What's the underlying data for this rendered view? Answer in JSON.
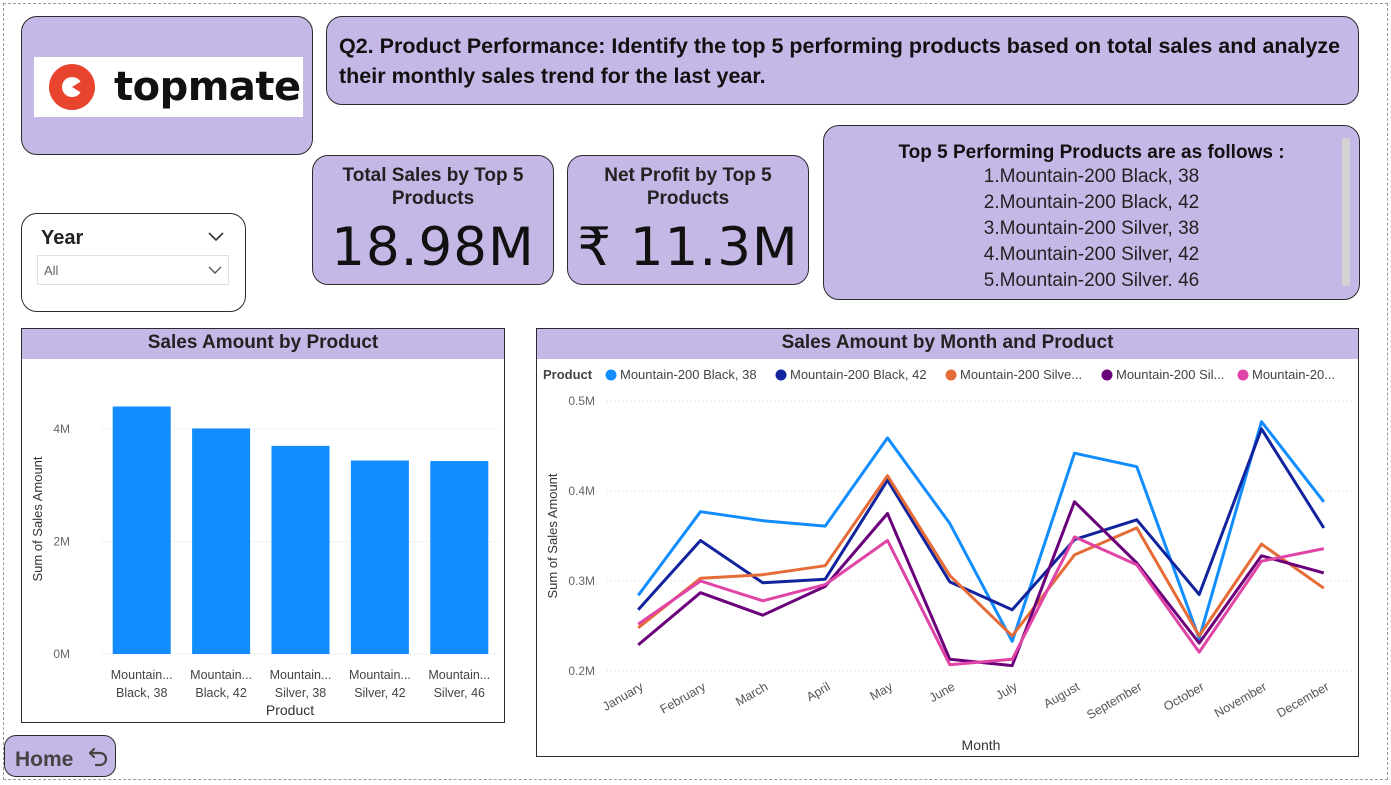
{
  "logo": {
    "text": "topmate",
    "brand_color": "#e8442e"
  },
  "question": {
    "text": "Q2. Product Performance: Identify the top 5 performing products based on total sales and analyze their monthly sales trend for the last year."
  },
  "year_slicer": {
    "title": "Year",
    "value": "All",
    "icon": "chevron-down-icon"
  },
  "kpis": {
    "total_sales": {
      "label": "Total Sales by Top 5 Products",
      "value": "18.98M"
    },
    "net_profit": {
      "label": "Net Profit by Top 5 Products",
      "value": "₹ 11.3M"
    }
  },
  "top5": {
    "title": "Top 5 Performing Products are as follows :",
    "items": [
      "1.Mountain-200 Black, 38",
      "2.Mountain-200 Black, 42",
      "3.Mountain-200 Silver, 38",
      "4.Mountain-200 Silver, 42",
      "5.Mountain-200 Silver. 46"
    ]
  },
  "home_button": {
    "label": "Home",
    "icon": "return-arrow-icon"
  },
  "colors": {
    "panel": "#c5b8e6",
    "bar": "#118dff",
    "accent_border": "#2b2b2b"
  },
  "chart_data": [
    {
      "type": "bar",
      "title": "Sales Amount by Product",
      "xlabel": "Product",
      "ylabel": "Sum of Sales Amount",
      "categories": [
        [
          "Mountain...",
          "Black, 38"
        ],
        [
          "Mountain...",
          "Black, 42"
        ],
        [
          "Mountain...",
          "Silver, 38"
        ],
        [
          "Mountain...",
          "Silver, 42"
        ],
        [
          "Mountain...",
          "Silver, 46"
        ]
      ],
      "values": [
        4.4,
        4.01,
        3.7,
        3.44,
        3.43
      ],
      "unit": "M",
      "ylim": [
        0,
        4.8
      ],
      "yticks": [
        {
          "v": 0,
          "label": "0M"
        },
        {
          "v": 2,
          "label": "2M"
        },
        {
          "v": 4,
          "label": "4M"
        }
      ],
      "grid": true
    },
    {
      "type": "line",
      "title": "Sales Amount by Month and Product",
      "xlabel": "Month",
      "ylabel": "Sum of Sales Amount",
      "legend_title": "Product",
      "legend_position": "top-left",
      "categories": [
        "January",
        "February",
        "March",
        "April",
        "May",
        "June",
        "July",
        "August",
        "September",
        "October",
        "November",
        "December"
      ],
      "ylim": [
        0.2,
        0.5
      ],
      "yticks": [
        {
          "v": 0.2,
          "label": "0.2M"
        },
        {
          "v": 0.3,
          "label": "0.3M"
        },
        {
          "v": 0.4,
          "label": "0.4M"
        },
        {
          "v": 0.5,
          "label": "0.5M"
        }
      ],
      "grid": true,
      "series": [
        {
          "name": "Mountain-200 Black, 38",
          "legend_label": "Mountain-200 Black, 38",
          "color": "#118dff",
          "values": [
            0.284,
            0.377,
            0.367,
            0.361,
            0.459,
            0.364,
            0.233,
            0.442,
            0.427,
            0.236,
            0.477,
            0.388
          ]
        },
        {
          "name": "Mountain-200 Black, 42",
          "legend_label": "Mountain-200 Black, 42",
          "color": "#12239e",
          "values": [
            0.268,
            0.345,
            0.298,
            0.302,
            0.412,
            0.299,
            0.268,
            0.346,
            0.368,
            0.285,
            0.469,
            0.359
          ]
        },
        {
          "name": "Mountain-200 Silver, 42",
          "legend_label": "Mountain-200 Silve...",
          "color": "#e66c37",
          "values": [
            0.248,
            0.303,
            0.307,
            0.317,
            0.417,
            0.306,
            0.239,
            0.329,
            0.359,
            0.239,
            0.341,
            0.292
          ]
        },
        {
          "name": "Mountain-200 Silver, 38",
          "legend_label": "Mountain-200 Sil...",
          "color": "#6b007b",
          "values": [
            0.229,
            0.287,
            0.262,
            0.294,
            0.375,
            0.213,
            0.206,
            0.388,
            0.32,
            0.231,
            0.328,
            0.309
          ]
        },
        {
          "name": "Mountain-200 Silver, 46",
          "legend_label": "Mountain-20...",
          "color": "#e044a7",
          "values": [
            0.252,
            0.3,
            0.278,
            0.296,
            0.345,
            0.207,
            0.213,
            0.349,
            0.318,
            0.221,
            0.322,
            0.336
          ]
        }
      ]
    }
  ]
}
